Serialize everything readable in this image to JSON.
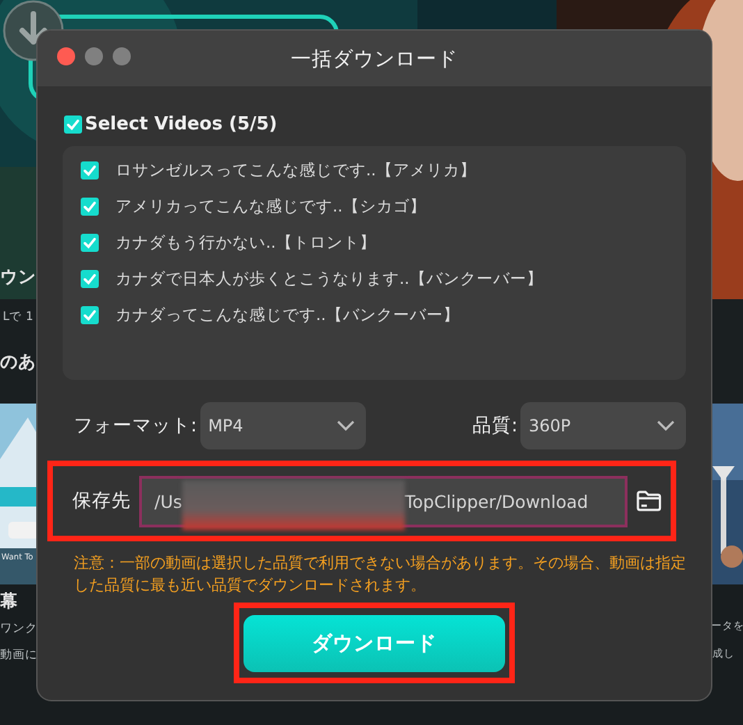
{
  "backdrop": {
    "left_column": [
      {
        "text": "ウン",
        "kind": "heading"
      },
      {
        "text": "Lで 1",
        "kind": "caption"
      },
      {
        "text": "のあ",
        "kind": "heading"
      },
      {
        "text": "Want To",
        "kind": "tiny"
      },
      {
        "text": "幕",
        "kind": "heading"
      },
      {
        "text": "ワンク",
        "kind": "caption"
      },
      {
        "text": "動画に",
        "kind": "caption"
      }
    ],
    "right_column": [
      {
        "text": "ータを",
        "kind": "small"
      },
      {
        "text": "成し",
        "kind": "small"
      }
    ]
  },
  "dialog": {
    "title": "一括ダウンロード",
    "select_all": {
      "label": "Select Videos (5/5)",
      "checked": true
    },
    "videos": [
      {
        "title": "ロサンゼルスってこんな感じです..【アメリカ】",
        "checked": true
      },
      {
        "title": "アメリカってこんな感じです..【シカゴ】",
        "checked": true
      },
      {
        "title": "カナダもう行かない..【トロント】",
        "checked": true
      },
      {
        "title": "カナダで日本人が歩くとこうなります..【バンクーバー】",
        "checked": true
      },
      {
        "title": "カナダってこんな感じです..【バンクーバー】",
        "checked": true
      }
    ],
    "format": {
      "label": "フォーマット:",
      "value": "MP4"
    },
    "quality": {
      "label": "品質:",
      "value": "360P"
    },
    "save_to": {
      "label": "保存先",
      "value_start": "/Us",
      "value_end": "TopClipper/Download"
    },
    "note": "注意：一部の動画は選択した品質で利用できない場合があります。その場合、動画は指定した品質に最も近い品質でダウンロードされます。",
    "download_button": "ダウンロード"
  }
}
